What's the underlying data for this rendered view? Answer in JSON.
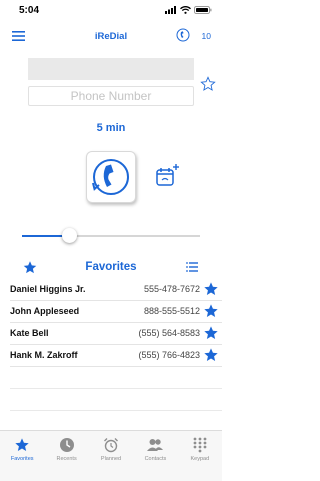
{
  "status_bar": {
    "time": "5:04"
  },
  "nav": {
    "title": "iReDial",
    "redial_count": "10"
  },
  "form": {
    "phone_placeholder": "Phone Number",
    "duration": "5 min"
  },
  "slider": {
    "value_fraction": 0.24
  },
  "favorites": {
    "title": "Favorites",
    "items": [
      {
        "name": "Daniel Higgins Jr.",
        "number": "555-478-7672"
      },
      {
        "name": "John Appleseed",
        "number": "888-555-5512"
      },
      {
        "name": "Kate Bell",
        "number": "(555) 564-8583"
      },
      {
        "name": "Hank M. Zakroff",
        "number": "(555) 766-4823"
      }
    ]
  },
  "tabs": [
    {
      "label": "Favorites",
      "icon": "star-icon",
      "active": true
    },
    {
      "label": "Recents",
      "icon": "clock-icon",
      "active": false
    },
    {
      "label": "Planned",
      "icon": "alarm-clock-icon",
      "active": false
    },
    {
      "label": "Contacts",
      "icon": "contacts-icon",
      "active": false
    },
    {
      "label": "Keypad",
      "icon": "keypad-icon",
      "active": false
    }
  ],
  "colors": {
    "accent": "#1c67d6",
    "inactive_tab": "#8e8e8e"
  }
}
